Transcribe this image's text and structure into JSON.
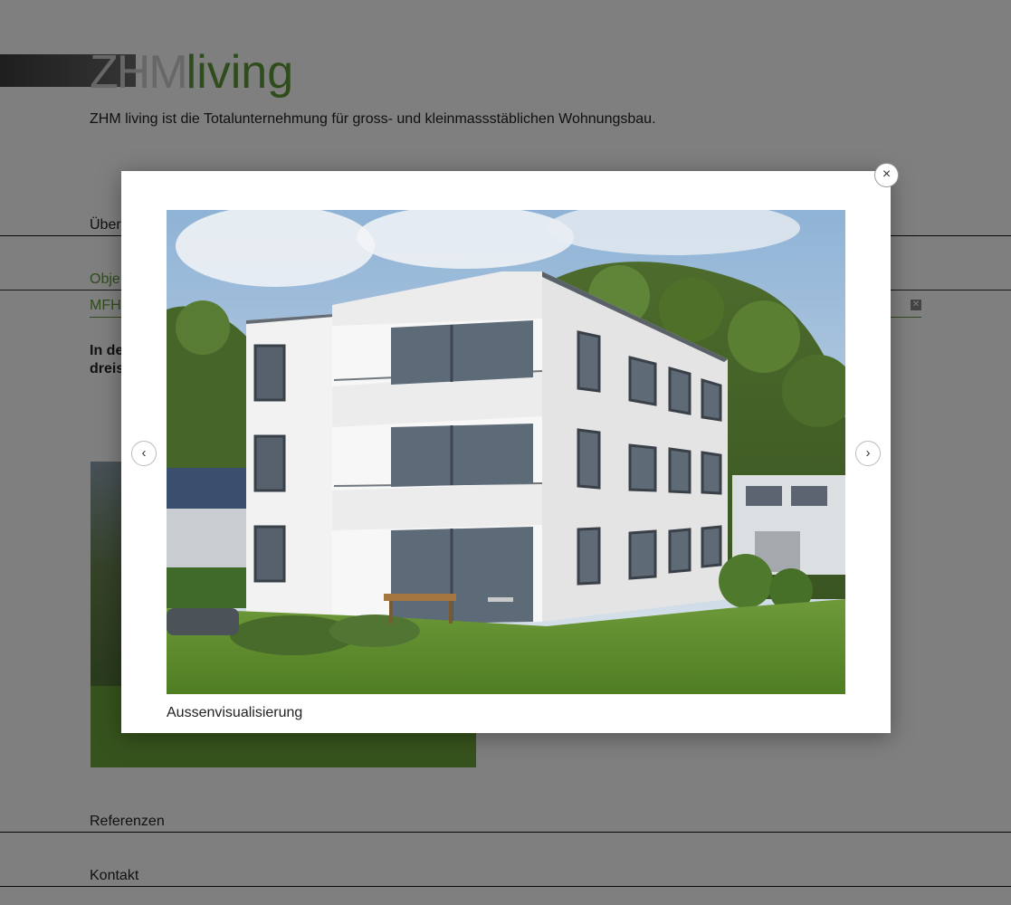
{
  "brand": {
    "logo_part1": "ZHM",
    "logo_part2": "living",
    "tagline": "ZHM living ist die Totalunternehmung für gross- und kleinmassstäblichen Wohnungsbau.",
    "accent_color": "#5e9838"
  },
  "navigation": {
    "items": [
      {
        "label": "Über"
      },
      {
        "label": "Obje"
      },
      {
        "label": "Referenzen"
      },
      {
        "label": "Kontakt"
      }
    ],
    "sub_item": {
      "label": "MFH"
    }
  },
  "intro": {
    "line1": "In de",
    "line2": "dreis"
  },
  "lightbox": {
    "caption": "Aussenvisualisierung",
    "close_symbol": "×",
    "prev_symbol": "‹",
    "next_symbol": "›",
    "image_subject": "three-storey white apartment building with balconies, lawn and forested hill"
  }
}
